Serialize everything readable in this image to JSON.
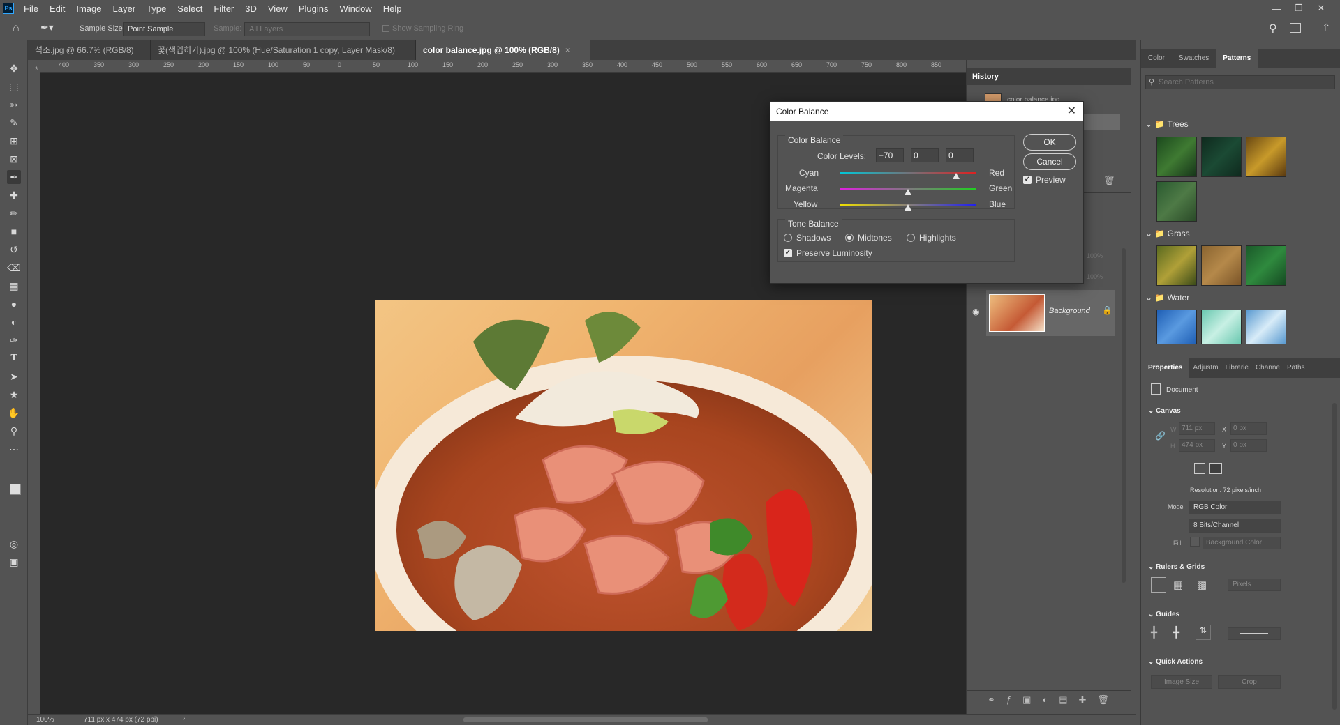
{
  "app": {
    "logo": "Ps"
  },
  "menu": [
    "File",
    "Edit",
    "Image",
    "Layer",
    "Type",
    "Select",
    "Filter",
    "3D",
    "View",
    "Plugins",
    "Window",
    "Help"
  ],
  "options": {
    "sample_size_label": "Sample Size:",
    "sample_size_value": "Point Sample",
    "sample_label": "Sample:",
    "sample_value": "All Layers",
    "sampling_ring": "Show Sampling Ring"
  },
  "tabs": [
    {
      "label": "석조.jpg @ 66.7% (RGB/8) *"
    },
    {
      "label": "꽃(색입히기).jpg @ 100% (Hue/Saturation 1 copy, Layer Mask/8) *"
    },
    {
      "label": "color balance.jpg @ 100% (RGB/8)"
    }
  ],
  "ruler_h": [
    "400",
    "350",
    "300",
    "250",
    "200",
    "150",
    "100",
    "50",
    "0",
    "50",
    "100",
    "150",
    "200",
    "250",
    "300",
    "350",
    "400",
    "450",
    "500",
    "550",
    "600",
    "650",
    "700",
    "750",
    "800",
    "850"
  ],
  "status": {
    "zoom": "100%",
    "doc_info": "711 px x 474 px (72 ppi)"
  },
  "history": {
    "title": "History",
    "item": "color balance.jpg"
  },
  "layers": {
    "opacity": "100%",
    "fill": "100%",
    "background_layer": "Background"
  },
  "right_tabs": [
    "Color",
    "Swatches",
    "Patterns"
  ],
  "patterns": {
    "search_placeholder": "Search Patterns",
    "groups": [
      "Trees",
      "Grass",
      "Water"
    ]
  },
  "properties_tabs": [
    "Properties",
    "Adjustm",
    "Librarie",
    "Channe",
    "Paths"
  ],
  "properties": {
    "document_label": "Document",
    "canvas_title": "Canvas",
    "w_label": "W",
    "w_value": "711 px",
    "h_label": "H",
    "h_value": "474 px",
    "x_label": "X",
    "x_value": "0 px",
    "y_label": "Y",
    "y_value": "0 px",
    "resolution": "Resolution: 72 pixels/inch",
    "mode_label": "Mode",
    "mode_value": "RGB Color",
    "depth_value": "8 Bits/Channel",
    "fill_label": "Fill",
    "fill_value": "Background Color",
    "rulers_title": "Rulers & Grids",
    "units_value": "Pixels",
    "guides_title": "Guides",
    "quick_title": "Quick Actions",
    "image_size": "Image Size",
    "crop": "Crop"
  },
  "dialog": {
    "title": "Color Balance",
    "group1": "Color Balance",
    "color_levels_label": "Color Levels:",
    "levels": [
      "+70",
      "0",
      "0"
    ],
    "cyan": "Cyan",
    "red": "Red",
    "magenta": "Magenta",
    "green": "Green",
    "yellow": "Yellow",
    "blue": "Blue",
    "slider_values": [
      70,
      0,
      0
    ],
    "group2": "Tone Balance",
    "shadows": "Shadows",
    "midtones": "Midtones",
    "highlights": "Highlights",
    "preserve": "Preserve Luminosity",
    "ok": "OK",
    "cancel": "Cancel",
    "preview": "Preview"
  }
}
